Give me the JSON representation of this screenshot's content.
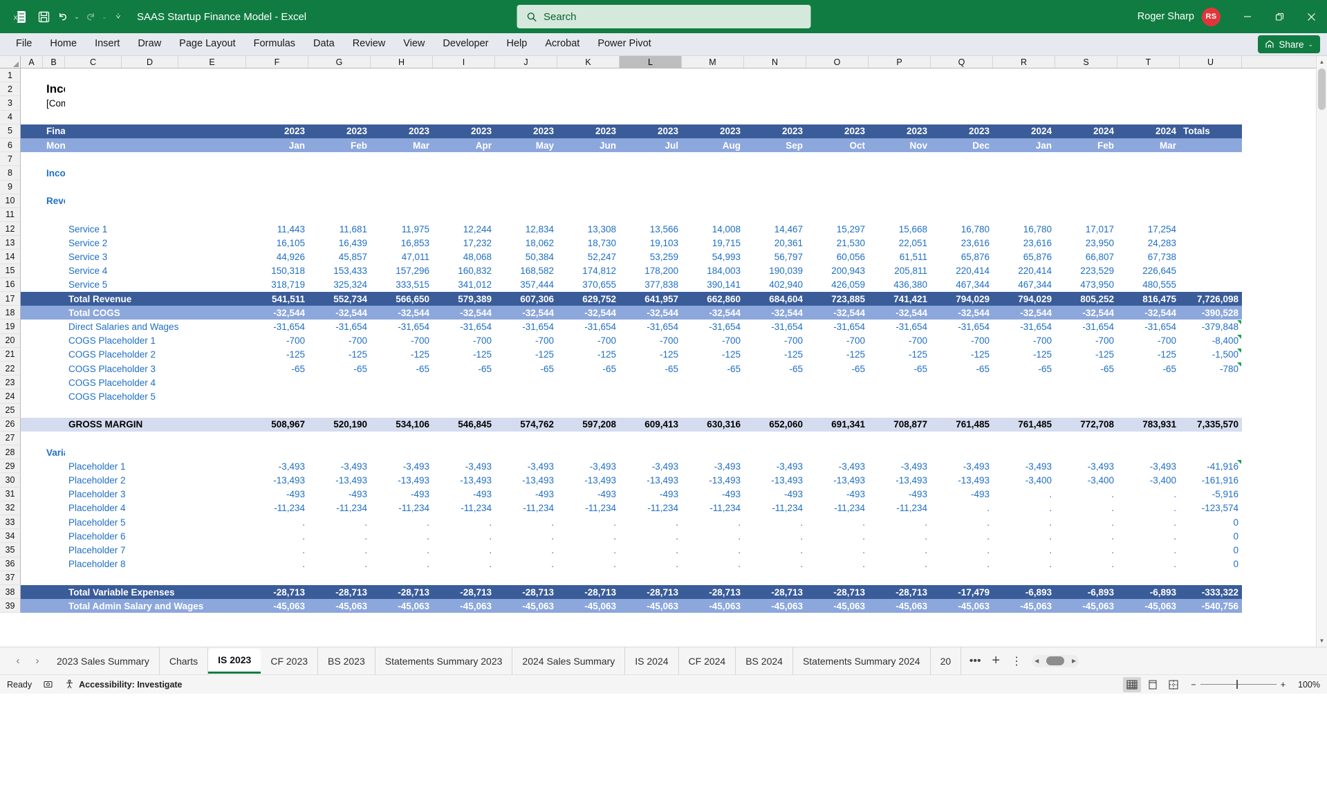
{
  "titlebar": {
    "doc_title": "SAAS Startup Finance Model  -  Excel",
    "search_placeholder": "Search",
    "user_name": "Roger Sharp",
    "avatar_initials": "RS",
    "qat": [
      "excel-logo",
      "save-icon",
      "undo-icon",
      "redo-icon",
      "customize-qat-icon"
    ],
    "window_buttons": [
      "minimize",
      "restore",
      "close"
    ],
    "brand_color": "#107C41"
  },
  "ribbon": {
    "tabs": [
      "File",
      "Home",
      "Insert",
      "Draw",
      "Page Layout",
      "Formulas",
      "Data",
      "Review",
      "View",
      "Developer",
      "Help",
      "Acrobat",
      "Power Pivot"
    ],
    "share_label": "Share"
  },
  "grid": {
    "columns": [
      "A",
      "B",
      "C",
      "D",
      "E",
      "F",
      "G",
      "H",
      "I",
      "J",
      "K",
      "L",
      "M",
      "N",
      "O",
      "P",
      "Q",
      "R",
      "S",
      "T",
      "U"
    ],
    "selected_column": "L",
    "row_numbers": [
      1,
      2,
      3,
      4,
      5,
      6,
      7,
      8,
      9,
      10,
      11,
      12,
      13,
      14,
      15,
      16,
      17,
      18,
      19,
      20,
      21,
      22,
      23,
      24,
      25,
      26,
      27,
      28,
      29,
      30,
      31,
      32,
      33,
      34,
      35,
      36,
      37,
      38,
      39
    ],
    "sheet_title": "Income Statement",
    "company_name": "[Company Name]",
    "section_currency": "Income Statement £",
    "financial_year_label": "Financial Year",
    "month_label": "Month",
    "totals_label": "Totals",
    "years": [
      "2023",
      "2023",
      "2023",
      "2023",
      "2023",
      "2023",
      "2023",
      "2023",
      "2023",
      "2023",
      "2023",
      "2023",
      "2024",
      "2024",
      "2024"
    ],
    "months": [
      "Jan",
      "Feb",
      "Mar",
      "Apr",
      "May",
      "Jun",
      "Jul",
      "Aug",
      "Sep",
      "Oct",
      "Nov",
      "Dec",
      "Jan",
      "Feb",
      "Mar"
    ],
    "revenue_header": "Revenue",
    "variable_expenses_header": "Variable Expenses",
    "rows": [
      {
        "r": 12,
        "label": "Service 1",
        "style": "item",
        "values": [
          "11,443",
          "11,681",
          "11,975",
          "12,244",
          "12,834",
          "13,308",
          "13,566",
          "14,008",
          "14,467",
          "15,297",
          "15,668",
          "16,780",
          "16,780",
          "17,017",
          "17,254"
        ],
        "total": ""
      },
      {
        "r": 13,
        "label": "Service 2",
        "style": "item",
        "values": [
          "16,105",
          "16,439",
          "16,853",
          "17,232",
          "18,062",
          "18,730",
          "19,103",
          "19,715",
          "20,361",
          "21,530",
          "22,051",
          "23,616",
          "23,616",
          "23,950",
          "24,283"
        ],
        "total": ""
      },
      {
        "r": 14,
        "label": "Service 3",
        "style": "item",
        "values": [
          "44,926",
          "45,857",
          "47,011",
          "48,068",
          "50,384",
          "52,247",
          "53,259",
          "54,993",
          "56,797",
          "60,056",
          "61,511",
          "65,876",
          "65,876",
          "66,807",
          "67,738"
        ],
        "total": ""
      },
      {
        "r": 15,
        "label": "Service 4",
        "style": "item",
        "values": [
          "150,318",
          "153,433",
          "157,296",
          "160,832",
          "168,582",
          "174,812",
          "178,200",
          "184,003",
          "190,039",
          "200,943",
          "205,811",
          "220,414",
          "220,414",
          "223,529",
          "226,645"
        ],
        "total": ""
      },
      {
        "r": 16,
        "label": "Service 5",
        "style": "item",
        "values": [
          "318,719",
          "325,324",
          "333,515",
          "341,012",
          "357,444",
          "370,655",
          "377,838",
          "390,141",
          "402,940",
          "426,059",
          "436,380",
          "467,344",
          "467,344",
          "473,950",
          "480,555"
        ],
        "total": ""
      },
      {
        "r": 17,
        "label": "Total Revenue",
        "style": "total-dark",
        "values": [
          "541,511",
          "552,734",
          "566,650",
          "579,389",
          "607,306",
          "629,752",
          "641,957",
          "662,860",
          "684,604",
          "723,885",
          "741,421",
          "794,029",
          "794,029",
          "805,252",
          "816,475"
        ],
        "total": "7,726,098"
      },
      {
        "r": 18,
        "label": "Total COGS",
        "style": "total-light",
        "values": [
          "-32,544",
          "-32,544",
          "-32,544",
          "-32,544",
          "-32,544",
          "-32,544",
          "-32,544",
          "-32,544",
          "-32,544",
          "-32,544",
          "-32,544",
          "-32,544",
          "-32,544",
          "-32,544",
          "-32,544"
        ],
        "total": "-390,528"
      },
      {
        "r": 19,
        "label": "Direct Salaries and Wages",
        "style": "item",
        "values": [
          "-31,654",
          "-31,654",
          "-31,654",
          "-31,654",
          "-31,654",
          "-31,654",
          "-31,654",
          "-31,654",
          "-31,654",
          "-31,654",
          "-31,654",
          "-31,654",
          "-31,654",
          "-31,654",
          "-31,654"
        ],
        "total": "-379,848",
        "note": true
      },
      {
        "r": 20,
        "label": "COGS Placeholder 1",
        "style": "item",
        "values": [
          "-700",
          "-700",
          "-700",
          "-700",
          "-700",
          "-700",
          "-700",
          "-700",
          "-700",
          "-700",
          "-700",
          "-700",
          "-700",
          "-700",
          "-700"
        ],
        "total": "-8,400",
        "note": true
      },
      {
        "r": 21,
        "label": "COGS Placeholder 2",
        "style": "item",
        "values": [
          "-125",
          "-125",
          "-125",
          "-125",
          "-125",
          "-125",
          "-125",
          "-125",
          "-125",
          "-125",
          "-125",
          "-125",
          "-125",
          "-125",
          "-125"
        ],
        "total": "-1,500",
        "note": true
      },
      {
        "r": 22,
        "label": "COGS Placeholder 3",
        "style": "item",
        "values": [
          "-65",
          "-65",
          "-65",
          "-65",
          "-65",
          "-65",
          "-65",
          "-65",
          "-65",
          "-65",
          "-65",
          "-65",
          "-65",
          "-65",
          "-65"
        ],
        "total": "-780",
        "note": true
      },
      {
        "r": 23,
        "label": "COGS Placeholder 4",
        "style": "item",
        "values": [
          "",
          "",
          "",
          "",
          "",
          "",
          "",
          "",
          "",
          "",
          "",
          "",
          "",
          "",
          ""
        ],
        "total": ""
      },
      {
        "r": 24,
        "label": "COGS Placeholder 5",
        "style": "item",
        "values": [
          "",
          "",
          "",
          "",
          "",
          "",
          "",
          "",
          "",
          "",
          "",
          "",
          "",
          "",
          ""
        ],
        "total": ""
      },
      {
        "r": 25,
        "label": "",
        "style": "blank",
        "values": [
          "",
          "",
          "",
          "",
          "",
          "",
          "",
          "",
          "",
          "",
          "",
          "",
          "",
          "",
          ""
        ],
        "total": ""
      },
      {
        "r": 26,
        "label": "GROSS MARGIN",
        "style": "gross-margin",
        "values": [
          "508,967",
          "520,190",
          "534,106",
          "546,845",
          "574,762",
          "597,208",
          "609,413",
          "630,316",
          "652,060",
          "691,341",
          "708,877",
          "761,485",
          "761,485",
          "772,708",
          "783,931"
        ],
        "total": "7,335,570"
      },
      {
        "r": 27,
        "label": "",
        "style": "blank",
        "values": [
          "",
          "",
          "",
          "",
          "",
          "",
          "",
          "",
          "",
          "",
          "",
          "",
          "",
          "",
          ""
        ],
        "total": ""
      },
      {
        "r": 29,
        "label": "Placeholder 1",
        "style": "item",
        "values": [
          "-3,493",
          "-3,493",
          "-3,493",
          "-3,493",
          "-3,493",
          "-3,493",
          "-3,493",
          "-3,493",
          "-3,493",
          "-3,493",
          "-3,493",
          "-3,493",
          "-3,493",
          "-3,493",
          "-3,493"
        ],
        "total": "-41,916",
        "note": true
      },
      {
        "r": 30,
        "label": "Placeholder 2",
        "style": "item",
        "values": [
          "-13,493",
          "-13,493",
          "-13,493",
          "-13,493",
          "-13,493",
          "-13,493",
          "-13,493",
          "-13,493",
          "-13,493",
          "-13,493",
          "-13,493",
          "-13,493",
          "-3,400",
          "-3,400",
          "-3,400"
        ],
        "total": "-161,916"
      },
      {
        "r": 31,
        "label": "Placeholder 3",
        "style": "item",
        "values": [
          "-493",
          "-493",
          "-493",
          "-493",
          "-493",
          "-493",
          "-493",
          "-493",
          "-493",
          "-493",
          "-493",
          "-493",
          ".",
          ".",
          "."
        ],
        "total": "-5,916"
      },
      {
        "r": 32,
        "label": "Placeholder 4",
        "style": "item",
        "values": [
          "-11,234",
          "-11,234",
          "-11,234",
          "-11,234",
          "-11,234",
          "-11,234",
          "-11,234",
          "-11,234",
          "-11,234",
          "-11,234",
          "-11,234",
          ".",
          ".",
          ".",
          "."
        ],
        "total": "-123,574"
      },
      {
        "r": 33,
        "label": "Placeholder 5",
        "style": "item",
        "values": [
          ".",
          ".",
          ".",
          ".",
          ".",
          ".",
          ".",
          ".",
          ".",
          ".",
          ".",
          ".",
          ".",
          ".",
          "."
        ],
        "total": "0"
      },
      {
        "r": 34,
        "label": "Placeholder 6",
        "style": "item",
        "values": [
          ".",
          ".",
          ".",
          ".",
          ".",
          ".",
          ".",
          ".",
          ".",
          ".",
          ".",
          ".",
          ".",
          ".",
          "."
        ],
        "total": "0"
      },
      {
        "r": 35,
        "label": "Placeholder 7",
        "style": "item",
        "values": [
          ".",
          ".",
          ".",
          ".",
          ".",
          ".",
          ".",
          ".",
          ".",
          ".",
          ".",
          ".",
          ".",
          ".",
          "."
        ],
        "total": "0"
      },
      {
        "r": 36,
        "label": "Placeholder 8",
        "style": "item",
        "values": [
          ".",
          ".",
          ".",
          ".",
          ".",
          ".",
          ".",
          ".",
          ".",
          ".",
          ".",
          ".",
          ".",
          ".",
          "."
        ],
        "total": "0"
      },
      {
        "r": 37,
        "label": "",
        "style": "blank",
        "values": [
          "",
          "",
          "",
          "",
          "",
          "",
          "",
          "",
          "",
          "",
          "",
          "",
          "",
          "",
          ""
        ],
        "total": ""
      },
      {
        "r": 38,
        "label": "Total Variable Expenses",
        "style": "total-dark",
        "values": [
          "-28,713",
          "-28,713",
          "-28,713",
          "-28,713",
          "-28,713",
          "-28,713",
          "-28,713",
          "-28,713",
          "-28,713",
          "-28,713",
          "-28,713",
          "-17,479",
          "-6,893",
          "-6,893",
          "-6,893"
        ],
        "total": "-333,322"
      },
      {
        "r": 39,
        "label": "Total Admin Salary and Wages",
        "style": "total-light",
        "values": [
          "-45,063",
          "-45,063",
          "-45,063",
          "-45,063",
          "-45,063",
          "-45,063",
          "-45,063",
          "-45,063",
          "-45,063",
          "-45,063",
          "-45,063",
          "-45,063",
          "-45,063",
          "-45,063",
          "-45,063"
        ],
        "total": "-540,756"
      }
    ]
  },
  "sheet_tabs": {
    "items": [
      {
        "label": "2023 Sales Summary",
        "active": false
      },
      {
        "label": "Charts",
        "active": false
      },
      {
        "label": "IS 2023",
        "active": true
      },
      {
        "label": "CF 2023",
        "active": false
      },
      {
        "label": "BS 2023",
        "active": false
      },
      {
        "label": "Statements Summary 2023",
        "active": false
      },
      {
        "label": "2024 Sales Summary",
        "active": false
      },
      {
        "label": "IS 2024",
        "active": false
      },
      {
        "label": "CF 2024",
        "active": false
      },
      {
        "label": "BS 2024",
        "active": false
      },
      {
        "label": "Statements Summary 2024",
        "active": false
      },
      {
        "label": "20",
        "active": false
      }
    ],
    "overflow_label": "•••",
    "add_sheet_label": "+",
    "more_label": "⋮"
  },
  "statusbar": {
    "status": "Ready",
    "accessibility": "Accessibility: Investigate",
    "zoom": "100%",
    "views": [
      "normal-view",
      "page-layout-view",
      "page-break-view"
    ]
  }
}
